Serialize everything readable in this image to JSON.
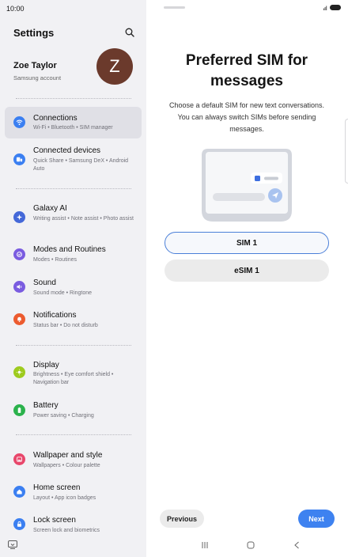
{
  "status_bar": {
    "time": "10:00"
  },
  "settings": {
    "title": "Settings",
    "profile": {
      "name": "Zoe Taylor",
      "account": "Samsung account",
      "avatar_letter": "Z"
    },
    "items": [
      {
        "title": "Connections",
        "sub": "Wi-Fi  •  Bluetooth  •  SIM manager",
        "icon": "wifi-icon",
        "color": "#3b7ff1"
      },
      {
        "title": "Connected devices",
        "sub": "Quick Share  •  Samsung DeX  •  Android Auto",
        "icon": "devices-icon",
        "color": "#3b7ff1"
      },
      {
        "title": "Galaxy AI",
        "sub": "Writing assist  •  Note assist  •  Photo assist",
        "icon": "sparkle-icon",
        "color": "#4468d8"
      },
      {
        "title": "Modes and Routines",
        "sub": "Modes  •  Routines",
        "icon": "modes-icon",
        "color": "#7a5ce0"
      },
      {
        "title": "Sound",
        "sub": "Sound mode  •  Ringtone",
        "icon": "speaker-icon",
        "color": "#7a5ce0"
      },
      {
        "title": "Notifications",
        "sub": "Status bar  •  Do not disturb",
        "icon": "bell-icon",
        "color": "#ec5b2f"
      },
      {
        "title": "Display",
        "sub": "Brightness  •  Eye comfort shield  •  Navigation bar",
        "icon": "sun-icon",
        "color": "#9ecb1f"
      },
      {
        "title": "Battery",
        "sub": "Power saving  •  Charging",
        "icon": "battery-icon",
        "color": "#2bb24c"
      },
      {
        "title": "Wallpaper and style",
        "sub": "Wallpapers  •  Colour palette",
        "icon": "wallpaper-icon",
        "color": "#e8476b"
      },
      {
        "title": "Home screen",
        "sub": "Layout  •  App icon badges",
        "icon": "home-icon",
        "color": "#3b7ff1"
      },
      {
        "title": "Lock screen",
        "sub": "Screen lock and biometrics",
        "icon": "lock-icon",
        "color": "#3b7ff1"
      }
    ]
  },
  "dialog": {
    "title_line1": "Preferred SIM for",
    "title_line2": "messages",
    "desc_line1": "Choose a default SIM for new text conversations.",
    "desc_line2": "You can always switch SIMs before sending",
    "desc_line3": "messages.",
    "options": [
      "SIM 1",
      "eSIM 1"
    ],
    "selected": "SIM 1",
    "previous_label": "Previous",
    "next_label": "Next"
  },
  "colors": {
    "accent": "#3e82f0",
    "panel_bg": "#f1f1f4",
    "avatar": "#6b3a2c"
  }
}
